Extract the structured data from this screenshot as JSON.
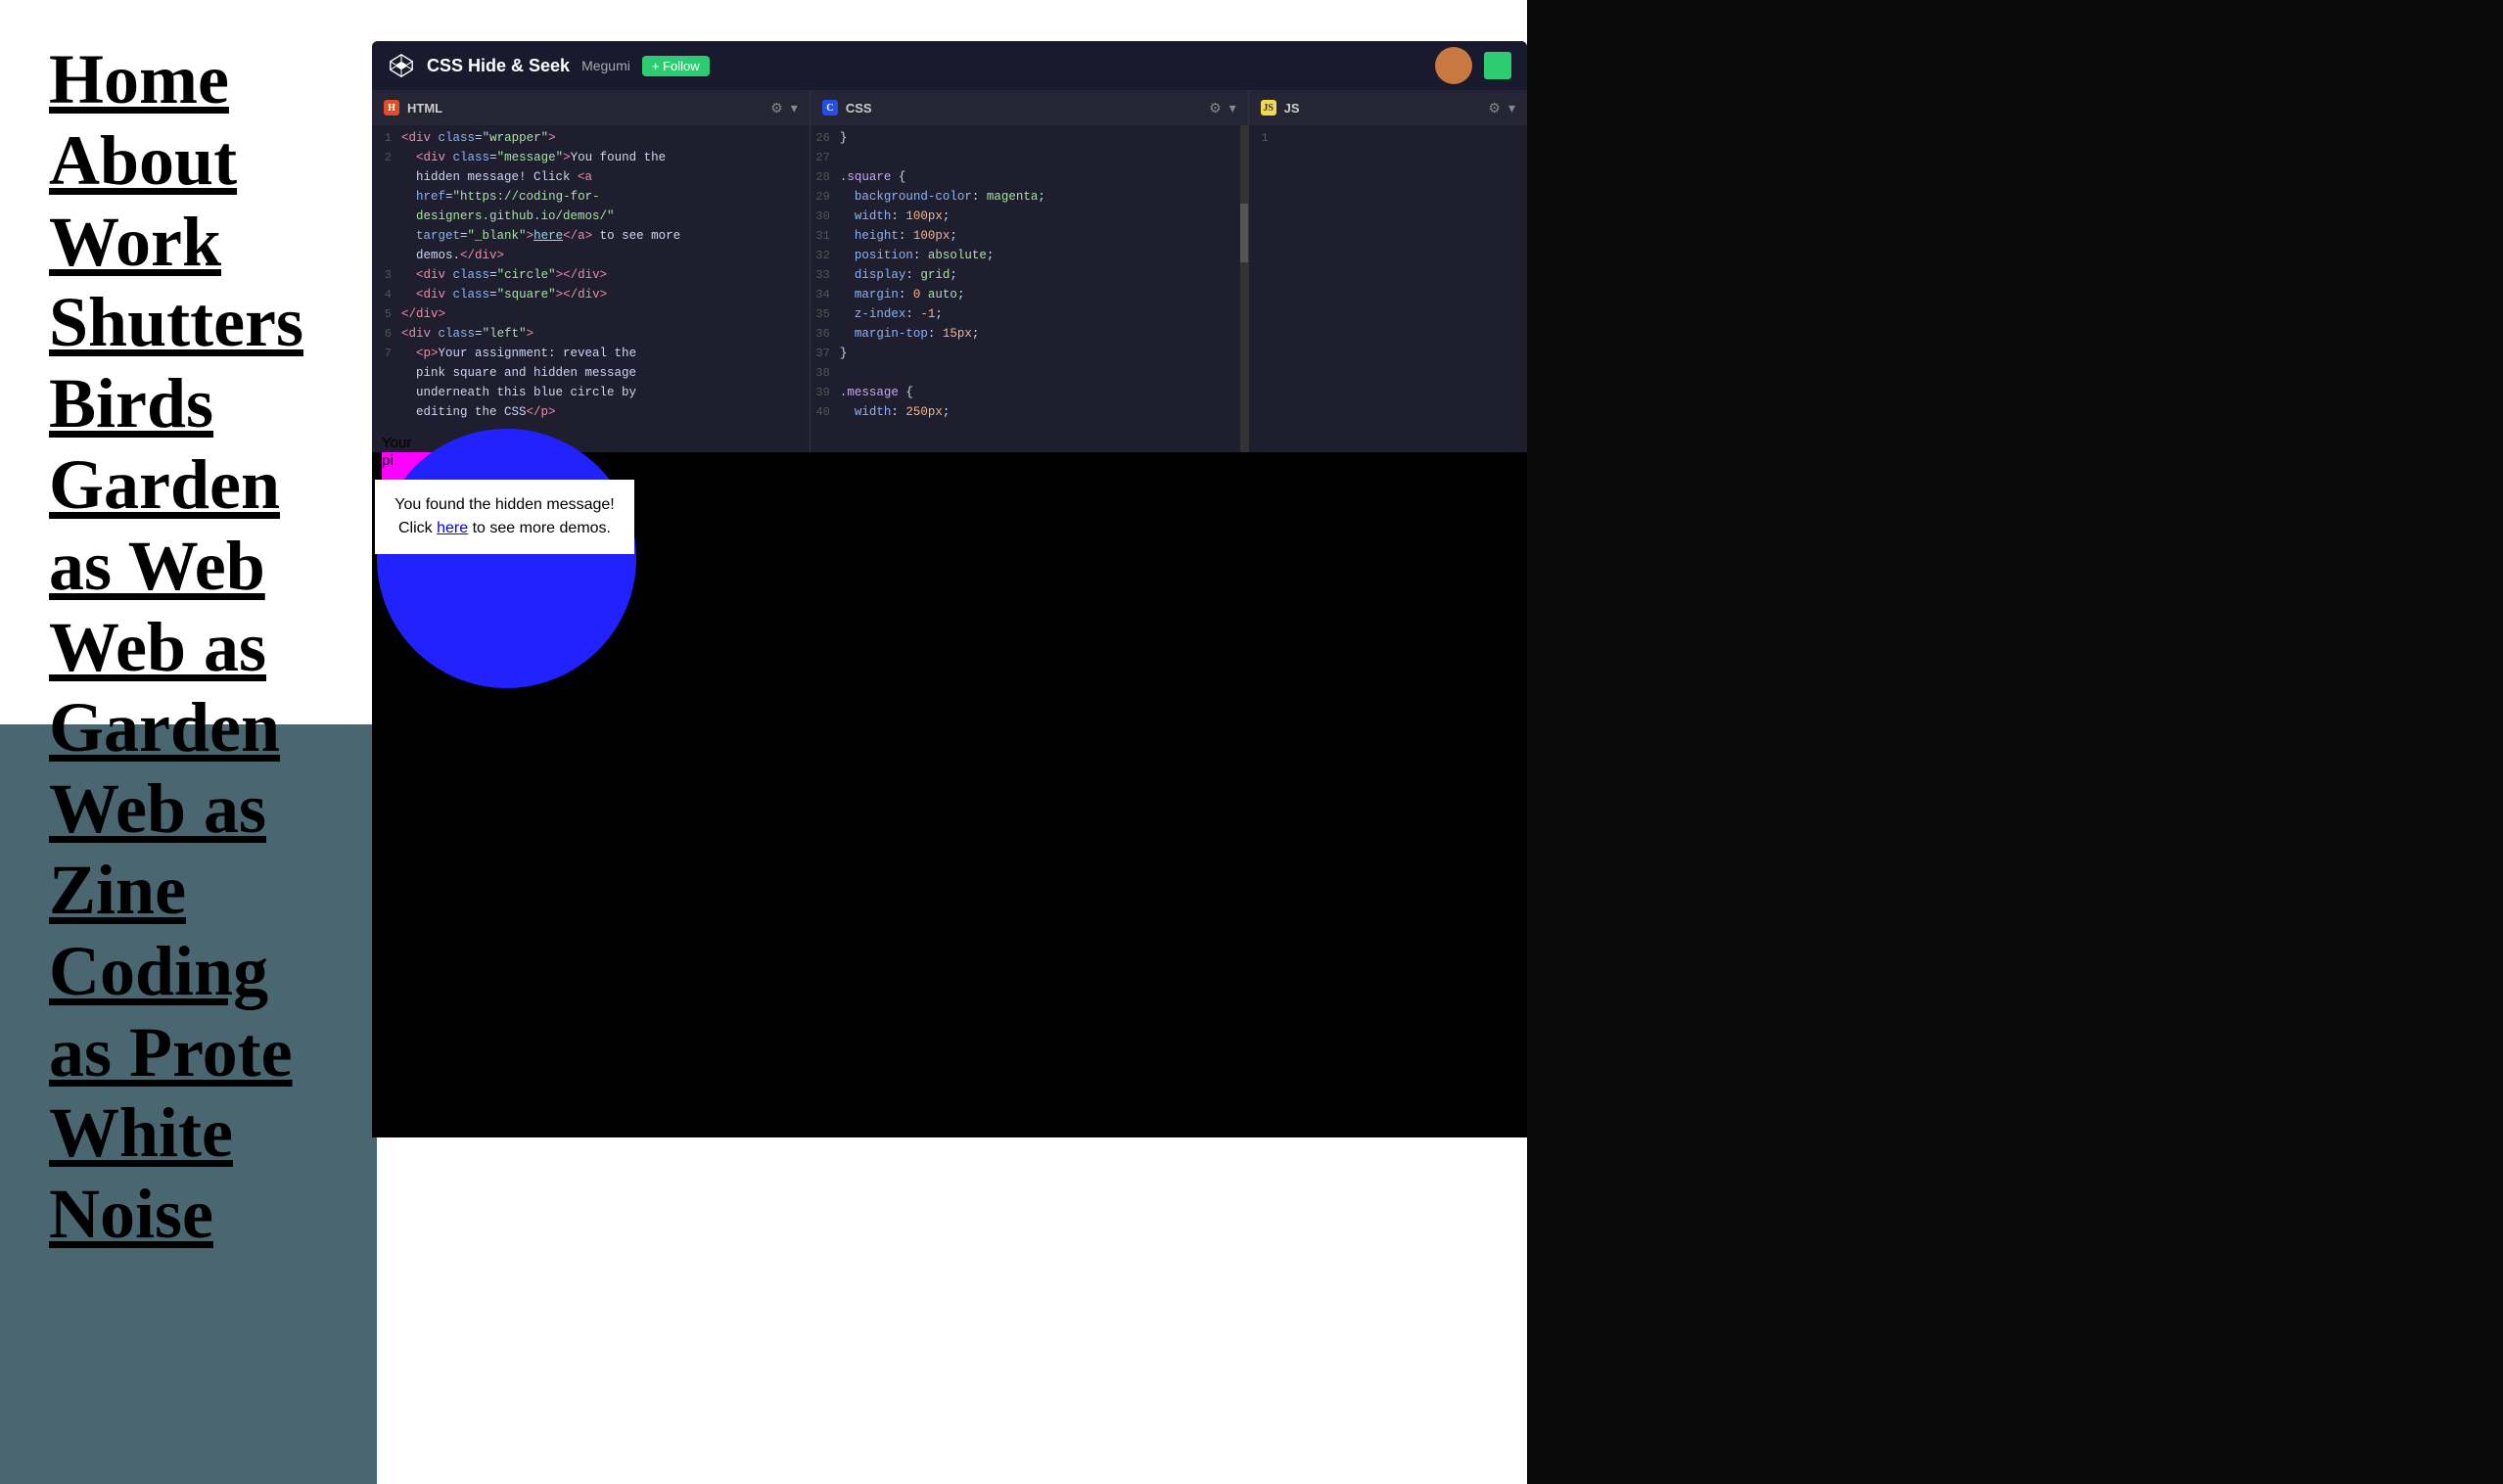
{
  "leftNav": {
    "items": [
      {
        "label": "Home",
        "href": "#"
      },
      {
        "label": "About",
        "href": "#"
      },
      {
        "label": "Work",
        "href": "#"
      },
      {
        "label": "Shutters",
        "href": "#"
      },
      {
        "label": "Birds",
        "href": "#"
      },
      {
        "label": "Garden as Web",
        "href": "#"
      },
      {
        "label": "Web as Garden",
        "href": "#"
      },
      {
        "label": "Web as Zine",
        "href": "#"
      },
      {
        "label": "Coding as Prote",
        "href": "#"
      },
      {
        "label": "White Noise",
        "href": "#"
      }
    ]
  },
  "codepen": {
    "title": "CSS Hide & Seek",
    "author": "Megumi",
    "followLabel": "+ Follow"
  },
  "htmlEditor": {
    "lang": "HTML",
    "lines": [
      {
        "num": "1",
        "content": "<div class=\"wrapper\">"
      },
      {
        "num": "2",
        "content": "  <div class=\"message\">You found the"
      },
      {
        "num": "",
        "content": "  hidden message! Click <a"
      },
      {
        "num": "",
        "content": "  href=\"https://coding-for-"
      },
      {
        "num": "",
        "content": "  designers.github.io/demos/\""
      },
      {
        "num": "",
        "content": "  target=\"_blank\">here</a> to see more"
      },
      {
        "num": "",
        "content": "  demos.</div>"
      },
      {
        "num": "3",
        "content": "  <div class=\"circle\"></div>"
      },
      {
        "num": "4",
        "content": "  <div class=\"square\"></div>"
      },
      {
        "num": "5",
        "content": "</div>"
      },
      {
        "num": "6",
        "content": "<div class=\"left\">"
      },
      {
        "num": "7",
        "content": "  <p>Your assignment: reveal the"
      },
      {
        "num": "",
        "content": "  pink square and hidden message"
      },
      {
        "num": "",
        "content": "  underneath this blue circle by"
      },
      {
        "num": "",
        "content": "  editing the CSS</p>"
      }
    ]
  },
  "cssEditor": {
    "lang": "CSS",
    "lines": [
      {
        "num": "26",
        "content": "}"
      },
      {
        "num": "27",
        "content": ""
      },
      {
        "num": "28",
        "content": ".square {"
      },
      {
        "num": "29",
        "content": "  background-color: magenta;"
      },
      {
        "num": "30",
        "content": "  width: 100px;"
      },
      {
        "num": "31",
        "content": "  height: 100px;"
      },
      {
        "num": "32",
        "content": "  position: absolute;"
      },
      {
        "num": "33",
        "content": "  display: grid;"
      },
      {
        "num": "34",
        "content": "  margin: 0 auto;"
      },
      {
        "num": "35",
        "content": "  z-index: -1;"
      },
      {
        "num": "36",
        "content": "  margin-top: 15px;"
      },
      {
        "num": "37",
        "content": "}"
      },
      {
        "num": "38",
        "content": ""
      },
      {
        "num": "39",
        "content": ".message {"
      },
      {
        "num": "40",
        "content": "  width: 250px;"
      }
    ]
  },
  "jsEditor": {
    "lang": "JS",
    "lines": [
      {
        "num": "1",
        "content": ""
      }
    ]
  },
  "preview": {
    "assignmentPartial": "Your",
    "assignmentPartial2": "pi",
    "blueCircle": true,
    "hiddenMessage": "You found the hidden message! Click here to see more demos.",
    "hereLink": "here"
  }
}
